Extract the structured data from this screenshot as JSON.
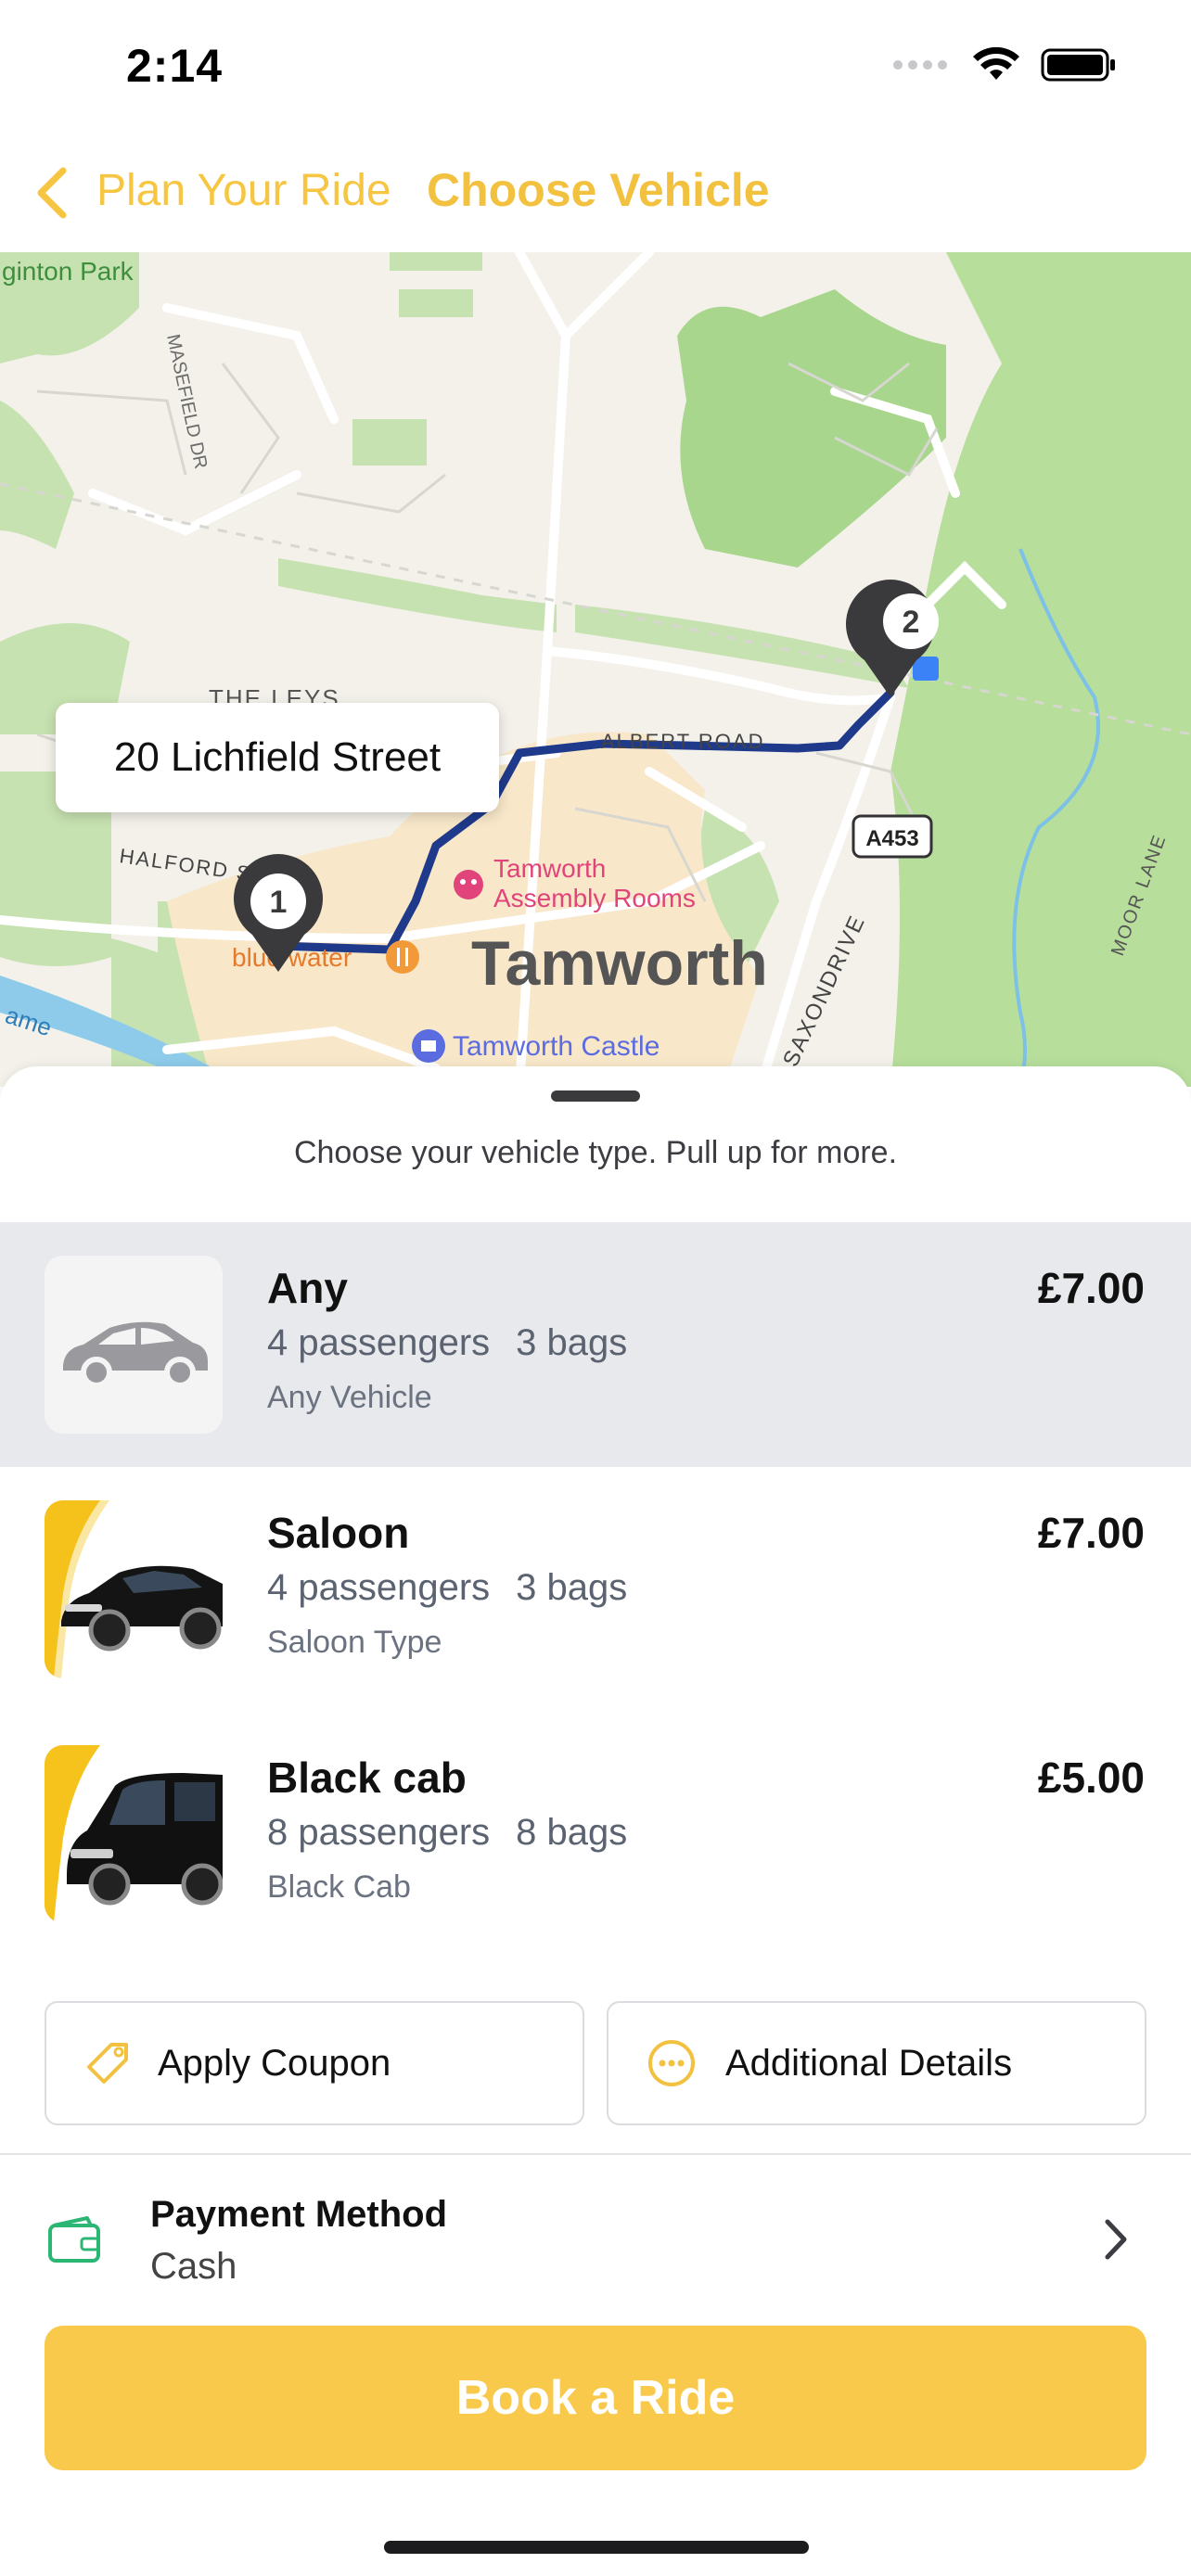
{
  "status_bar": {
    "time": "2:14"
  },
  "nav": {
    "back_label": "Plan Your Ride",
    "title": "Choose Vehicle",
    "accent": "#F2C140"
  },
  "map": {
    "address_callout": "20 Lichfield Street",
    "labels": {
      "park": "ginton Park",
      "masefield": "MASEFIELD DR",
      "leys": "THE LEYS",
      "albert": "ALBERT ROAD",
      "halford": "HALFORD ST",
      "assembly1": "Tamworth",
      "assembly2": "Assembly Rooms",
      "bluewater": "blue water",
      "town": "Tamworth",
      "castle": "Tamworth Castle",
      "saxon": "SAXONDRIVE",
      "road_badge": "A453",
      "moor": "MOOR LANE",
      "ame": "ame"
    },
    "pins": {
      "start": "1",
      "end": "2"
    }
  },
  "sheet": {
    "hint": "Choose your vehicle type. Pull up for more.",
    "vehicles": [
      {
        "name": "Any",
        "passengers": "4 passengers",
        "bags": "3 bags",
        "type": "Any Vehicle",
        "price": "£7.00",
        "icon": "car-icon",
        "selected": true
      },
      {
        "name": "Saloon",
        "passengers": "4 passengers",
        "bags": "3 bags",
        "type": "Saloon Type",
        "price": "£7.00",
        "icon": "saloon-photo",
        "selected": false
      },
      {
        "name": "Black cab",
        "passengers": "8 passengers",
        "bags": "8 bags",
        "type": "Black Cab",
        "price": "£5.00",
        "icon": "van-photo",
        "selected": false
      }
    ],
    "actions": {
      "coupon": "Apply Coupon",
      "details": "Additional Details"
    },
    "payment": {
      "title": "Payment Method",
      "value": "Cash"
    },
    "book": "Book a Ride"
  },
  "colors": {
    "brand_yellow": "#F8C94A",
    "route": "#1F3A8A",
    "pin": "#3A3A3C",
    "wallet_green": "#2BB673"
  }
}
